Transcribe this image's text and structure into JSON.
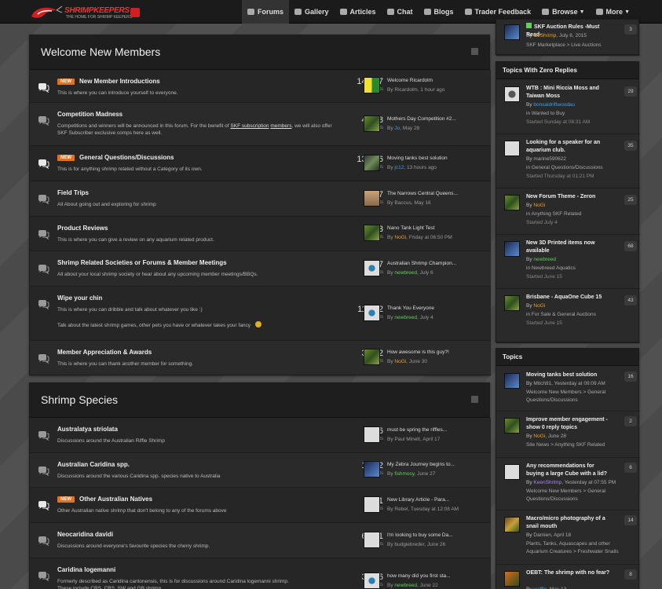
{
  "site": {
    "logo_text": "SHRIMPKEEPERS",
    "logo_sub": "THE HOME FOR SHRIMP KEEPERS"
  },
  "nav": [
    {
      "label": "Forums",
      "active": true
    },
    {
      "label": "Gallery"
    },
    {
      "label": "Articles"
    },
    {
      "label": "Chat"
    },
    {
      "label": "Blogs"
    },
    {
      "label": "Trader Feedback"
    },
    {
      "label": "Browse",
      "caret": true
    },
    {
      "label": "More",
      "caret": true
    }
  ],
  "welcome": {
    "title": "Welcome New Members",
    "rows": [
      {
        "title": "New Member Introductions",
        "new": "NEW",
        "desc": "This is where you can introduce yourself to everyone.",
        "count": "14,827",
        "count_label": "posts",
        "last_title": "Welcome Ricardolm",
        "last_by": "By",
        "last_user": "Ricardolm",
        "last_time": "1 hour ago"
      },
      {
        "title": "Competition Madness",
        "desc1": "Competitions and winners will be announced in this forum. For the benefit of",
        "desc_link1": "SKF subscription",
        "desc_link2": "members",
        "desc2": ", we will also offer SKF Subscriber exclusive comps here as well.",
        "count": "4,318",
        "count_label": "posts",
        "last_title": "Mothers Day Competition #2...",
        "last_by": "By",
        "last_user": "Jo",
        "last_time": "May 28"
      },
      {
        "title": "General Questions/Discussions",
        "new": "NEW",
        "desc": "This is for anything shrimp related without a Category of its own.",
        "count": "13,686",
        "count_label": "posts",
        "last_title": "Moving tanks best solution",
        "last_by": "By",
        "last_user": "jc12",
        "last_time": "13 hours ago"
      },
      {
        "title": "Field Trips",
        "desc": "All About going out and exploring for shrimp",
        "count": "897",
        "count_label": "posts",
        "last_title": "The Narrows Central Queens...",
        "last_by": "By",
        "last_user": "Baccus",
        "last_time": "May 16"
      },
      {
        "title": "Product Reviews",
        "desc": "This is where you can give a review on any aquarium related product.",
        "count": "413",
        "count_label": "posts",
        "last_title": "Nano Tank Light Test",
        "last_by": "By",
        "last_user": "NoGi",
        "last_time": "Friday at 06:50 PM"
      },
      {
        "title": "Shrimp Related Societies or Forums & Member Meetings",
        "desc": "All about your local shrimp society or hear about any upcoming member meetings/BBQs.",
        "count": "997",
        "count_label": "posts",
        "last_title": "Australian Shrimp Champion...",
        "last_by": "By",
        "last_user": "newbreed",
        "last_time": "July 6"
      },
      {
        "title": "Wipe your chin",
        "desc": "This is where you can dribble and talk about whatever you like :)",
        "desc_extra": "Talk about the latest shrimp games, other pets you have or whatever takes your fancy",
        "count": "11,932",
        "count_label": "posts",
        "last_title": "Thank You Everyone",
        "last_by": "By",
        "last_user": "newbreed",
        "last_time": "July 4"
      },
      {
        "title": "Member Appreciation & Awards",
        "desc": "This is where you can thank another member for something.",
        "count": "3,872",
        "count_label": "posts",
        "last_title": "How awesome is this guy?!",
        "last_by": "By",
        "last_user": "NoGi",
        "last_time": "June 30"
      }
    ]
  },
  "species": {
    "title": "Shrimp Species",
    "rows": [
      {
        "title": "Australatya striolata",
        "desc": "Discussions around the Australian Riffle Shrimp",
        "count": "326",
        "count_label": "posts",
        "last_title": "must be spring the riffles...",
        "last_by": "By",
        "last_user": "Paul Minett",
        "last_time": "April 17"
      },
      {
        "title": "Australian Caridina spp.",
        "desc": "Discussions around the various Caridina spp. species native to Australia",
        "count": "1,752",
        "count_label": "posts",
        "last_title": "My Zebra Journey begins to...",
        "last_by": "By",
        "last_user": "fishmosy",
        "last_time": "June 27"
      },
      {
        "title": "Other Australian Natives",
        "new": "NEW",
        "desc": "Other Australian native shrimp that don't belong to any of the forums above",
        "count": "611",
        "count_label": "posts",
        "last_title": "New Library Article - Para...",
        "last_by": "By",
        "last_user": "Rebel",
        "last_time": "Tuesday at 12:08 AM"
      },
      {
        "title": "Neocaridina davidi",
        "desc": "Discussions around everyone's favourite species the cherry shrimp.",
        "count": "6,271",
        "count_label": "posts",
        "last_title": "I'm looking to buy some Da...",
        "last_by": "By",
        "last_user": "budgiebreder",
        "last_time": "June 26"
      },
      {
        "title": "Caridina logemanni",
        "desc": "Formerly described as Caridina cantonensis, this is for discussions around Caridina logemanni shrimp.",
        "desc_extra": "These include CRS, CBS, SW and GB shrimp",
        "count": "3,436",
        "count_label": "posts",
        "last_title": "how many did you first sta...",
        "last_by": "By",
        "last_user": "newbreed",
        "last_time": "June 22"
      }
    ]
  },
  "top_snip": {
    "title": "SKF Auction Rules -Must Read-",
    "by": "By",
    "user": "OzShrimp",
    "time": "July 8, 2015",
    "path": "SKF Marketplace > Live Auctions",
    "count": "3"
  },
  "zero_replies": {
    "title": "Topics With Zero Replies",
    "items": [
      {
        "title": "WTB : Mini Riccia Moss and Taiwan Moss",
        "by": "By",
        "user": "bonsaidriftwoodau",
        "in": "in Wanted to Buy",
        "started": "Started Sunday at 08:31 AM",
        "count": "29"
      },
      {
        "title": "Looking for a speaker for an aquarium club.",
        "by": "By",
        "user": "marine590622",
        "in": "in General Questions/Discussions",
        "started": "Started Thursday at 01:21 PM",
        "count": "35"
      },
      {
        "title": "New Forum Theme - Zeron",
        "by": "By",
        "user": "NoGi",
        "in": "in Anything SKF Related",
        "started": "Started July 4",
        "count": "25"
      },
      {
        "title": "New 3D Printed items now available",
        "by": "By",
        "user": "newbreed",
        "in": "in Newbreed Aquatics",
        "started": "Started June 15",
        "count": "68"
      },
      {
        "title": "Brisbane - AquaOne Cube 15",
        "by": "By",
        "user": "NoGi",
        "in": "in For Sale & General Auctions",
        "started": "Started June 15",
        "count": "43"
      }
    ]
  },
  "topics": {
    "title": "Topics",
    "items": [
      {
        "title": "Moving tanks best solution",
        "by": "By",
        "user": "Mitch91",
        "time": "Yesterday at 09:09 AM",
        "path": "Welcome New Members > General Questions/Discussions",
        "count": "16"
      },
      {
        "title": "Improve member engagement - show 0 reply topics",
        "by": "By",
        "user": "NoGi",
        "time": "June 28",
        "path": "Site News > Anything SKF Related",
        "count": "2"
      },
      {
        "title": "Any recommendations for buying a large Cube with a lid?",
        "by": "By",
        "user": "KeenShrimp",
        "time": "Yesterday at 07:55 PM",
        "path": "Welcome New Members > General Questions/Discussions",
        "count": "6"
      },
      {
        "title": "Macro/micro photography of a snail mouth",
        "by": "By",
        "user": "Damien",
        "time": "April 18",
        "path": "Plants, Tanks, Aquascapes and other Aquarium Creatures > Freshwater Snails",
        "count": "14"
      },
      {
        "title": "OEBT: The shrimp with no fear?",
        "by": "By",
        "user": "waffle",
        "time": "May 13",
        "path": "",
        "count": "8"
      }
    ]
  }
}
